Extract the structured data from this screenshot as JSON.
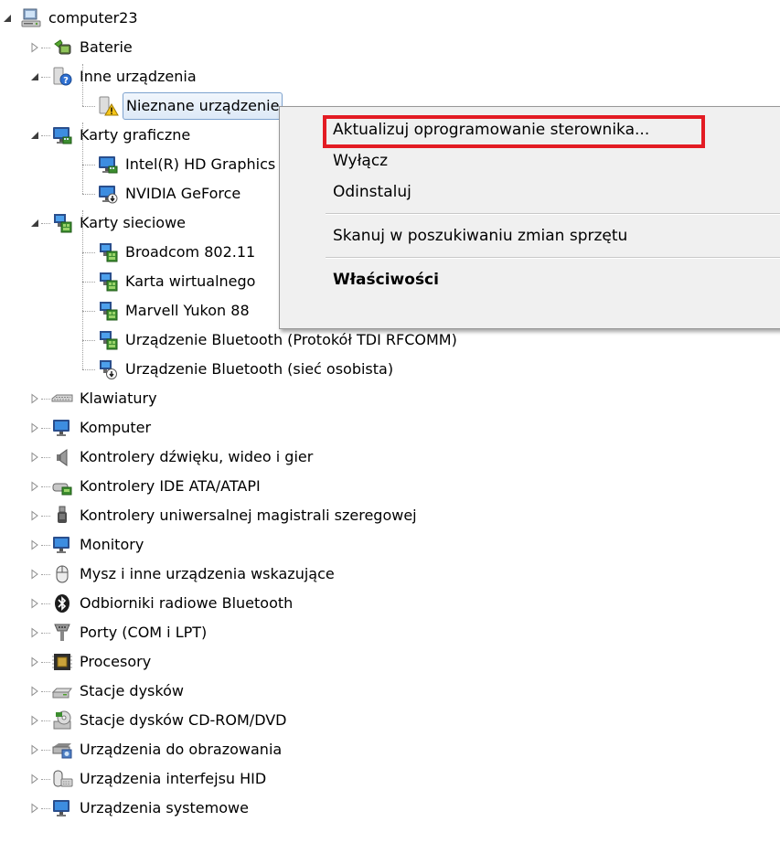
{
  "tree": {
    "root": {
      "label": "computer23",
      "icon": "computer-icon",
      "expanded": true
    },
    "rows": [
      {
        "label": "Baterie",
        "icon": "battery-icon",
        "level": 1,
        "expander": "collapsed"
      },
      {
        "label": "Inne urządzenia",
        "icon": "unknown-device-icon",
        "level": 1,
        "expander": "expanded"
      },
      {
        "label": "Nieznane urządzenie",
        "icon": "warning-device-icon",
        "level": 2,
        "expander": "none",
        "selected": true
      },
      {
        "label": "Karty graficzne",
        "icon": "display-adapter-icon",
        "level": 1,
        "expander": "expanded"
      },
      {
        "label": "Intel(R) HD Graphics",
        "icon": "display-adapter-icon",
        "level": 2,
        "expander": "none"
      },
      {
        "label": "NVIDIA GeForce",
        "icon": "display-adapter-disabled-icon",
        "level": 2,
        "expander": "none"
      },
      {
        "label": "Karty sieciowe",
        "icon": "network-adapter-icon",
        "level": 1,
        "expander": "expanded"
      },
      {
        "label": "Broadcom 802.11",
        "icon": "network-adapter-icon",
        "level": 2,
        "expander": "none"
      },
      {
        "label": "Karta wirtualnego",
        "icon": "network-adapter-icon",
        "level": 2,
        "expander": "none"
      },
      {
        "label": "Marvell Yukon 88",
        "icon": "network-adapter-icon",
        "level": 2,
        "expander": "none"
      },
      {
        "label": "Urządzenie Bluetooth (Protokół TDI RFCOMM)",
        "icon": "network-adapter-icon",
        "level": 2,
        "expander": "none"
      },
      {
        "label": "Urządzenie Bluetooth (sieć osobista)",
        "icon": "network-adapter-disabled-icon",
        "level": 2,
        "expander": "none"
      },
      {
        "label": "Klawiatury",
        "icon": "keyboard-icon",
        "level": 1,
        "expander": "collapsed"
      },
      {
        "label": "Komputer",
        "icon": "monitor-icon",
        "level": 1,
        "expander": "collapsed"
      },
      {
        "label": "Kontrolery dźwięku, wideo i gier",
        "icon": "speaker-icon",
        "level": 1,
        "expander": "collapsed"
      },
      {
        "label": "Kontrolery IDE ATA/ATAPI",
        "icon": "ide-controller-icon",
        "level": 1,
        "expander": "collapsed"
      },
      {
        "label": "Kontrolery uniwersalnej magistrali szeregowej",
        "icon": "usb-icon",
        "level": 1,
        "expander": "collapsed"
      },
      {
        "label": "Monitory",
        "icon": "monitor-icon",
        "level": 1,
        "expander": "collapsed"
      },
      {
        "label": "Mysz i inne urządzenia wskazujące",
        "icon": "mouse-icon",
        "level": 1,
        "expander": "collapsed"
      },
      {
        "label": "Odbiorniki radiowe Bluetooth",
        "icon": "bluetooth-icon",
        "level": 1,
        "expander": "collapsed"
      },
      {
        "label": "Porty (COM i LPT)",
        "icon": "port-icon",
        "level": 1,
        "expander": "collapsed"
      },
      {
        "label": "Procesory",
        "icon": "processor-icon",
        "level": 1,
        "expander": "collapsed"
      },
      {
        "label": "Stacje dysków",
        "icon": "disk-drive-icon",
        "level": 1,
        "expander": "collapsed"
      },
      {
        "label": "Stacje dysków CD-ROM/DVD",
        "icon": "cd-drive-icon",
        "level": 1,
        "expander": "collapsed"
      },
      {
        "label": "Urządzenia do obrazowania",
        "icon": "imaging-device-icon",
        "level": 1,
        "expander": "collapsed"
      },
      {
        "label": "Urządzenia interfejsu HID",
        "icon": "hid-icon",
        "level": 1,
        "expander": "collapsed"
      },
      {
        "label": "Urządzenia systemowe",
        "icon": "monitor-icon",
        "level": 1,
        "expander": "collapsed"
      }
    ]
  },
  "context_menu": {
    "items": [
      {
        "label": "Aktualizuj oprogramowanie sterownika...",
        "highlighted": true
      },
      {
        "label": "Wyłącz"
      },
      {
        "label": "Odinstaluj"
      },
      {
        "separator": true
      },
      {
        "label": "Skanuj w poszukiwaniu zmian sprzętu"
      },
      {
        "separator": true
      },
      {
        "label": "Właściwości",
        "bold": true
      }
    ]
  },
  "colors": {
    "selection_border": "#7da2ce",
    "highlight_box": "#e31b23",
    "menu_background": "#f0f0f0"
  }
}
